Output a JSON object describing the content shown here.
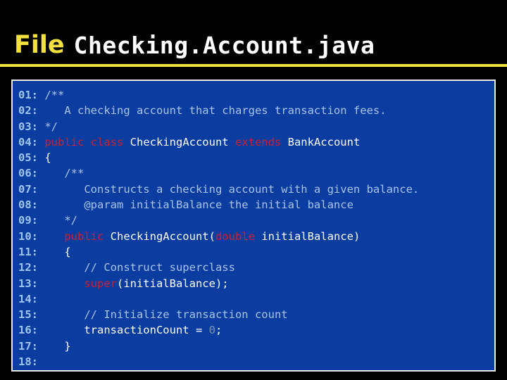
{
  "slide": {
    "title_label": "File",
    "title_filename": "Checking.Account.java",
    "accent_color": "#f2e03c",
    "panel_bg_color": "#0b3ca0",
    "panel_border_color": "#e8e8e8"
  },
  "code": {
    "language": "java",
    "colors": {
      "lineno": "#9ec6f0",
      "plain": "#ffffff",
      "comment": "#a9c4e8",
      "keyword": "#cc1f33",
      "number": "#7f93ad"
    },
    "lines": [
      {
        "no": "01:",
        "tokens": [
          {
            "t": "comment",
            "s": " /**"
          }
        ]
      },
      {
        "no": "02:",
        "tokens": [
          {
            "t": "comment",
            "s": "    A checking account that charges transaction fees."
          }
        ]
      },
      {
        "no": "03:",
        "tokens": [
          {
            "t": "comment",
            "s": " */"
          }
        ]
      },
      {
        "no": "04:",
        "tokens": [
          {
            "t": "keyword",
            "s": " public class"
          },
          {
            "t": "plain",
            "s": " CheckingAccount"
          },
          {
            "t": "keyword",
            "s": " extends"
          },
          {
            "t": "plain",
            "s": " BankAccount"
          }
        ]
      },
      {
        "no": "05:",
        "tokens": [
          {
            "t": "plain",
            "s": " {"
          }
        ]
      },
      {
        "no": "06:",
        "tokens": [
          {
            "t": "comment",
            "s": "    /**"
          }
        ]
      },
      {
        "no": "07:",
        "tokens": [
          {
            "t": "comment",
            "s": "       Constructs a checking account with a given balance."
          }
        ]
      },
      {
        "no": "08:",
        "tokens": [
          {
            "t": "comment",
            "s": "       @param initialBalance the initial balance"
          }
        ]
      },
      {
        "no": "09:",
        "tokens": [
          {
            "t": "comment",
            "s": "    */"
          }
        ]
      },
      {
        "no": "10:",
        "tokens": [
          {
            "t": "keyword",
            "s": "    public"
          },
          {
            "t": "plain",
            "s": " CheckingAccount("
          },
          {
            "t": "keyword",
            "s": "double"
          },
          {
            "t": "plain",
            "s": " initialBalance)"
          }
        ]
      },
      {
        "no": "11:",
        "tokens": [
          {
            "t": "plain",
            "s": "    {"
          }
        ]
      },
      {
        "no": "12:",
        "tokens": [
          {
            "t": "comment",
            "s": "       // Construct superclass"
          }
        ]
      },
      {
        "no": "13:",
        "tokens": [
          {
            "t": "keyword",
            "s": "       super"
          },
          {
            "t": "plain",
            "s": "(initialBalance);"
          }
        ]
      },
      {
        "no": "14:",
        "tokens": [
          {
            "t": "plain",
            "s": ""
          }
        ]
      },
      {
        "no": "15:",
        "tokens": [
          {
            "t": "comment",
            "s": "       // Initialize transaction count"
          }
        ]
      },
      {
        "no": "16:",
        "tokens": [
          {
            "t": "plain",
            "s": "       transactionCount = "
          },
          {
            "t": "number",
            "s": "0"
          },
          {
            "t": "plain",
            "s": ";"
          }
        ]
      },
      {
        "no": "17:",
        "tokens": [
          {
            "t": "plain",
            "s": "    }"
          }
        ]
      },
      {
        "no": "18:",
        "tokens": [
          {
            "t": "plain",
            "s": ""
          }
        ]
      }
    ]
  }
}
